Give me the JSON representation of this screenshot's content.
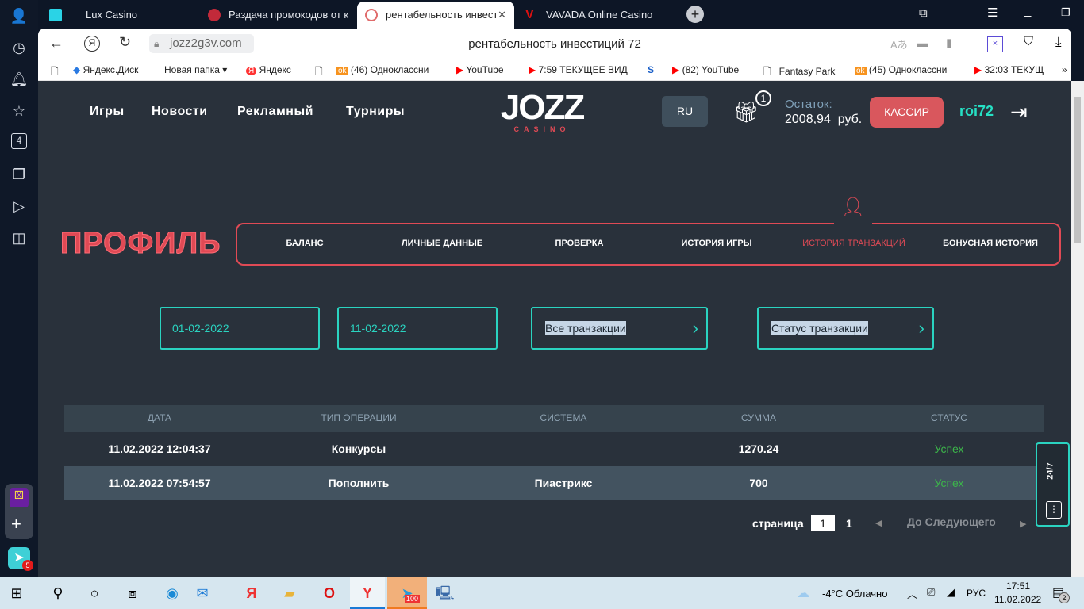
{
  "browser": {
    "tabs": [
      {
        "label": "Lux Casino"
      },
      {
        "label": "Раздача промокодов от к"
      },
      {
        "label": "рентабельность инвест",
        "active": true
      },
      {
        "label": "VAVADA Online Casino"
      }
    ],
    "url": "jozz2g3v.com",
    "page_title": "рентабельность инвестиций 72",
    "bookmarks": [
      "Яндекс.Диск",
      "Новая папка",
      "Яндекс",
      "(46) Одноклассни",
      "YouTube",
      "7:59 ТЕКУЩЕЕ ВИД",
      "(82) YouTube",
      "Fantasy Park",
      "(45) Одноклассни",
      "32:03 ТЕКУЩ"
    ],
    "sidebar_badge": "4",
    "app_badge": "5"
  },
  "header": {
    "nav": [
      "Игры",
      "Новости",
      "Рекламный",
      "Турниры"
    ],
    "logo": "JOZZ",
    "logo_sub": "CASINO",
    "lang": "RU",
    "gift_count": "1",
    "balance_label": "Остаток:",
    "balance_value": "2008,94",
    "balance_currency": "руб.",
    "cashier": "КАССИР",
    "username": "roi72"
  },
  "profile": {
    "title": "ПРОФИЛЬ",
    "tabs": [
      "БАЛАНС",
      "ЛИЧНЫЕ ДАННЫЕ",
      "ПРОВЕРКА",
      "ИСТОРИЯ ИГРЫ",
      "ИСТОРИЯ ТРАНЗАКЦИЙ",
      "БОНУСНАЯ ИСТОРИЯ"
    ],
    "active_tab": "ИСТОРИЯ ТРАНЗАКЦИЙ"
  },
  "filters": {
    "date_from": "01-02-2022",
    "date_to": "11-02-2022",
    "type": "Все транзакции",
    "status": "Статус транзакции"
  },
  "table": {
    "headers": [
      "ДАТА",
      "ТИП ОПЕРАЦИИ",
      "СИСТЕМА",
      "СУММА",
      "СТАТУС"
    ],
    "rows": [
      [
        "11.02.2022 12:04:37",
        "Конкурсы",
        "",
        "1270.24",
        "Успех"
      ],
      [
        "11.02.2022 07:54:57",
        "Пополнить",
        "Пиастрикс",
        "700",
        "Успех"
      ]
    ]
  },
  "pagination": {
    "label": "страница",
    "current": "1",
    "total": "1",
    "next": "До Следующего"
  },
  "support": {
    "label": "24/7"
  },
  "taskbar": {
    "weather": "-4°C  Облачно",
    "lang": "РУС",
    "time": "17:51",
    "date": "11.02.2022",
    "notif": "2",
    "telegram_badge": "100"
  },
  "colors": {
    "bg": "#29313b",
    "accent_red": "#e04a55",
    "accent_teal": "#2ad3c0",
    "success": "#3cb54a"
  }
}
